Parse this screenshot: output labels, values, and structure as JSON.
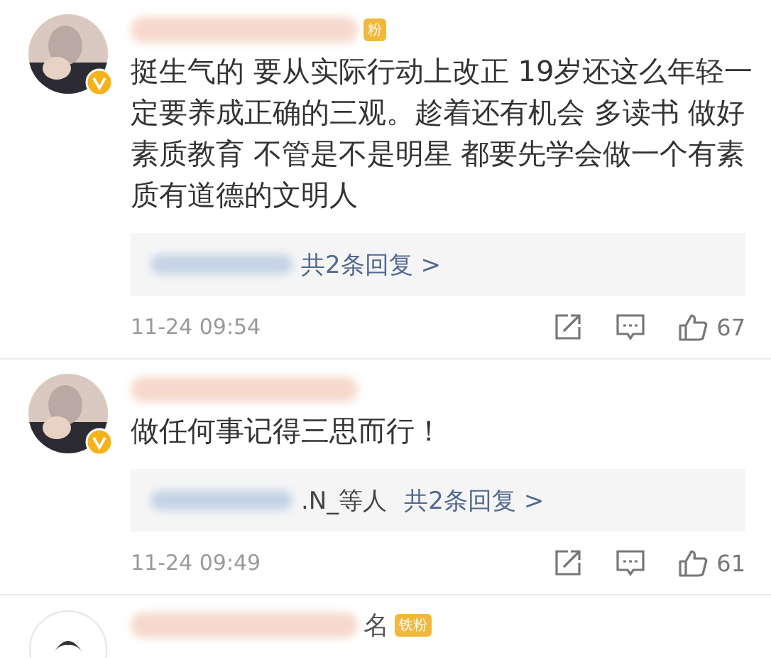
{
  "comments": [
    {
      "badge": "粉",
      "text": "挺生气的 要从实际行动上改正 19岁还这么年轻一定要养成正确的三观。趁着还有机会 多读书 做好素质教育 不管是不是明星 都要先学会做一个有素质有道德的文明人",
      "replies": {
        "link": "共2条回复 >"
      },
      "time": "11-24 09:54",
      "likes": "67"
    },
    {
      "text": "做任何事记得三思而行！",
      "replies": {
        "names": ".N_等人",
        "link": "共2条回复 >"
      },
      "time": "11-24 09:49",
      "likes": "61"
    },
    {
      "badge": "铁粉",
      "name_tail": "名"
    }
  ]
}
